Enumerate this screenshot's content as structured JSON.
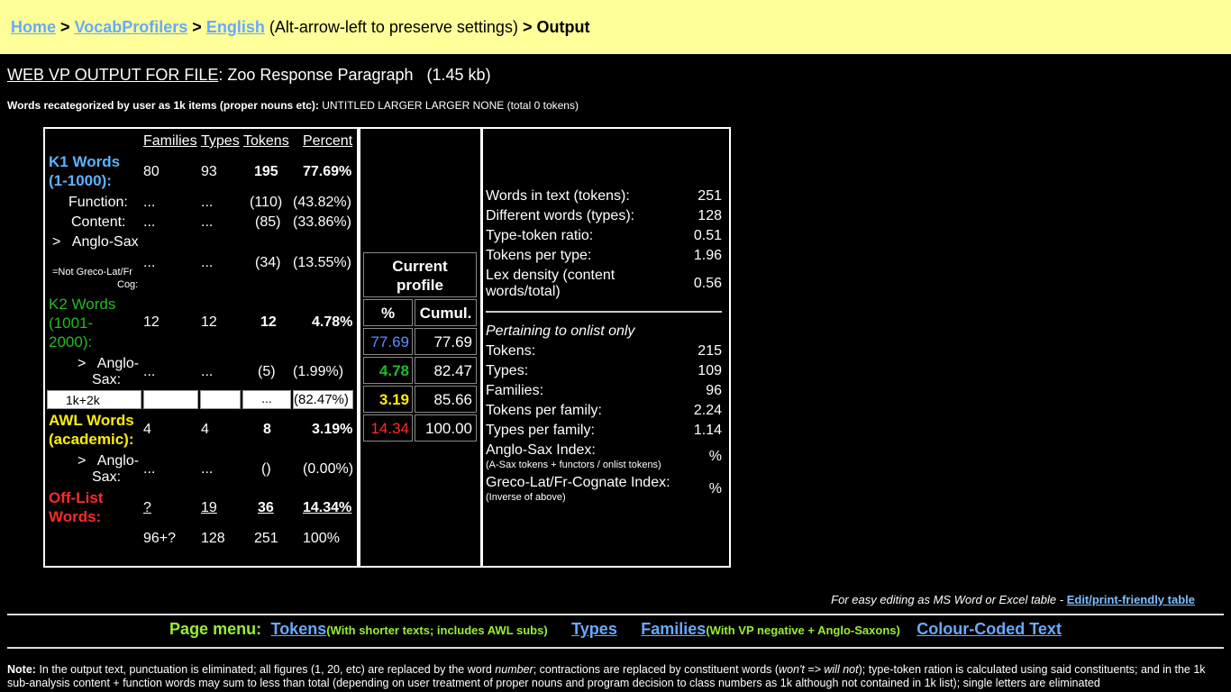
{
  "breadcrumb": {
    "home": "Home",
    "sep1": ">",
    "vocabprofilers": "VocabProfilers",
    "sep2": ">",
    "english": "English",
    "hint": "(Alt-arrow-left to preserve settings)",
    "sep3": ">",
    "current": "Output"
  },
  "heading": {
    "label": "WEB VP OUTPUT FOR FILE",
    "file": ": Zoo Response Paragraph",
    "size": "(1.45 kb)"
  },
  "recategorized": {
    "label": "Words recategorized by user as 1k items (proper nouns etc):",
    "value": "UNTITLED LARGER LARGER NONE (total 0 tokens)"
  },
  "left_table": {
    "headers": {
      "families": "Families",
      "types": "Types",
      "tokens": "Tokens",
      "percent": "Percent"
    },
    "k1": {
      "label1": "K1 Words",
      "label2": "(1-1000):",
      "families": "80",
      "types": "93",
      "tokens": "195",
      "percent": "77.69%"
    },
    "function": {
      "label": "Function:",
      "families": "...",
      "types": "...",
      "tokens": "(110)",
      "percent": "(43.82%)"
    },
    "content": {
      "label": "Content:",
      "families": "...",
      "types": "...",
      "tokens": "(85)",
      "percent": "(33.86%)"
    },
    "anglosax1": {
      "label": ">   Anglo-Sax"
    },
    "notgreco": {
      "label1": "=Not Greco-Lat/Fr",
      "label2": "Cog:",
      "families": "...",
      "types": "...",
      "tokens": "(34)",
      "percent": "(13.55%)"
    },
    "k2": {
      "label1": "K2 Words",
      "label2": "(1001-",
      "label3": "2000):",
      "families": "12",
      "types": "12",
      "tokens": "12",
      "percent": "4.78%"
    },
    "anglosax2": {
      "label1": ">   Anglo-",
      "label2": "Sax:",
      "families": "...",
      "types": "...",
      "tokens": "(5)",
      "percent": "(1.99%)"
    },
    "k1k2": {
      "label": "1k+2k",
      "families": "",
      "types": "",
      "tokens": "...",
      "percent": "(82.47%)"
    },
    "awl": {
      "label1": "AWL Words",
      "label2": "(academic):",
      "families": "4",
      "types": "4",
      "tokens": "8",
      "percent": "3.19%"
    },
    "anglosax3": {
      "label1": ">   Anglo-",
      "label2": "Sax:",
      "families": "...",
      "types": "...",
      "tokens": "()",
      "percent": "(0.00%)"
    },
    "offlist": {
      "label1": "Off-List",
      "label2": "Words:",
      "families": "?",
      "types": "19",
      "tokens": "36",
      "percent": "14.34%"
    },
    "total": {
      "families": "96+?",
      "types": "128",
      "tokens": "251",
      "percent": "100%"
    }
  },
  "current_profile": {
    "title1": "Current",
    "title2": "profile",
    "col_pct": "%",
    "col_cumul": "Cumul.",
    "rows": [
      {
        "pct": "77.69",
        "cumul": "77.69",
        "color": "#5b8cff"
      },
      {
        "pct": "4.78",
        "cumul": "82.47",
        "color": "#22bb22"
      },
      {
        "pct": "3.19",
        "cumul": "85.66",
        "color": "#ffee00"
      },
      {
        "pct": "14.34",
        "cumul": "100.00",
        "color": "#ff2a2a"
      }
    ]
  },
  "stats": {
    "words_in_text_label": "Words in text (tokens):",
    "words_in_text": "251",
    "different_words_label": "Different words (types):",
    "different_words": "128",
    "ttr_label": "Type-token ratio:",
    "ttr": "0.51",
    "tpt_label": "Tokens per type:",
    "tpt": "1.96",
    "lexdens_label1": "Lex density (content",
    "lexdens_label2": "words/total)",
    "lexdens": "0.56",
    "onlist_heading": "Pertaining to onlist only",
    "tokens_label": "Tokens:",
    "tokens": "215",
    "types_label": "Types:",
    "types": "109",
    "families_label": "Families:",
    "families": "96",
    "tpf_label": "Tokens per family:",
    "tpf": "2.24",
    "typf_label": "Types per family:",
    "typf": "1.14",
    "asi_label": "Anglo-Sax Index:",
    "asi_sub": "(A-Sax tokens + functors / onlist tokens)",
    "asi": "%",
    "glfci_label": "Greco-Lat/Fr-Cognate Index:",
    "glfci_sub": "(Inverse of above)",
    "glfci": "%"
  },
  "edit_note": {
    "text": "For easy editing as MS Word or Excel table -",
    "link": "Edit/print-friendly table"
  },
  "page_menu": {
    "label": "Page menu:",
    "tokens": "Tokens",
    "tokens_sub": "(With shorter texts; includes AWL subs)",
    "types": "Types",
    "families": "Families",
    "families_sub": "(With VP negative + Anglo-Saxons)",
    "colour": "Colour-Coded Text"
  },
  "note": {
    "label": "Note:",
    "text1": "In the output text, punctuation is eliminated; all figures (1, 20, etc) are replaced by the word",
    "number_word": "number",
    "text2": "; contractions are replaced by constituent words (",
    "wont_example": "won't => will not",
    "text3": "); type-token ration is calculated using said constituents; and in the 1k sub-analysis content + function words may sum to less than total (depending on user treatment of proper nouns and program decision to class numbers as 1k although not contained in 1k list); single letters are eliminated"
  }
}
